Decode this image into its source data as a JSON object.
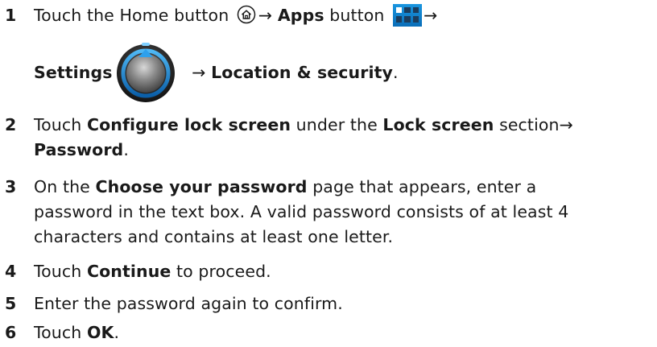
{
  "steps": [
    {
      "number": "1",
      "line1": {
        "pre": "Touch the Home button",
        "arrow1": "→",
        "apps_label": "Apps",
        "apps_suffix": " button",
        "arrow2": "→"
      },
      "line2": {
        "settings_label": "Settings",
        "arrow": "→",
        "location_label": "Location & security",
        "end": "."
      }
    },
    {
      "number": "2",
      "line1": {
        "pre": "Touch ",
        "configure_label": "Configure lock screen",
        "mid": " under the ",
        "lock_label": "Lock screen",
        "post": " section→"
      },
      "line2": {
        "password_label": "Password",
        "end": "."
      }
    },
    {
      "number": "3",
      "line1": {
        "pre": "On the ",
        "choose_label": "Choose your password",
        "post": " page that appears, enter a"
      },
      "line2": "password in the text box. A valid password consists of at least 4",
      "line3": "characters and contains at least one letter."
    },
    {
      "number": "4",
      "pre": "Touch ",
      "continue_label": "Continue",
      "post": " to proceed."
    },
    {
      "number": "5",
      "text": "Enter the password again to confirm."
    },
    {
      "number": "6",
      "pre": "Touch ",
      "ok_label": "OK",
      "end": "."
    }
  ],
  "icons": {
    "home": "home-icon",
    "apps": "apps-icon",
    "settings": "settings-icon"
  },
  "colors": {
    "text": "#1a1a1a",
    "apps_icon_bg": "#0f84cf",
    "settings_ring": "#1e88d6"
  }
}
